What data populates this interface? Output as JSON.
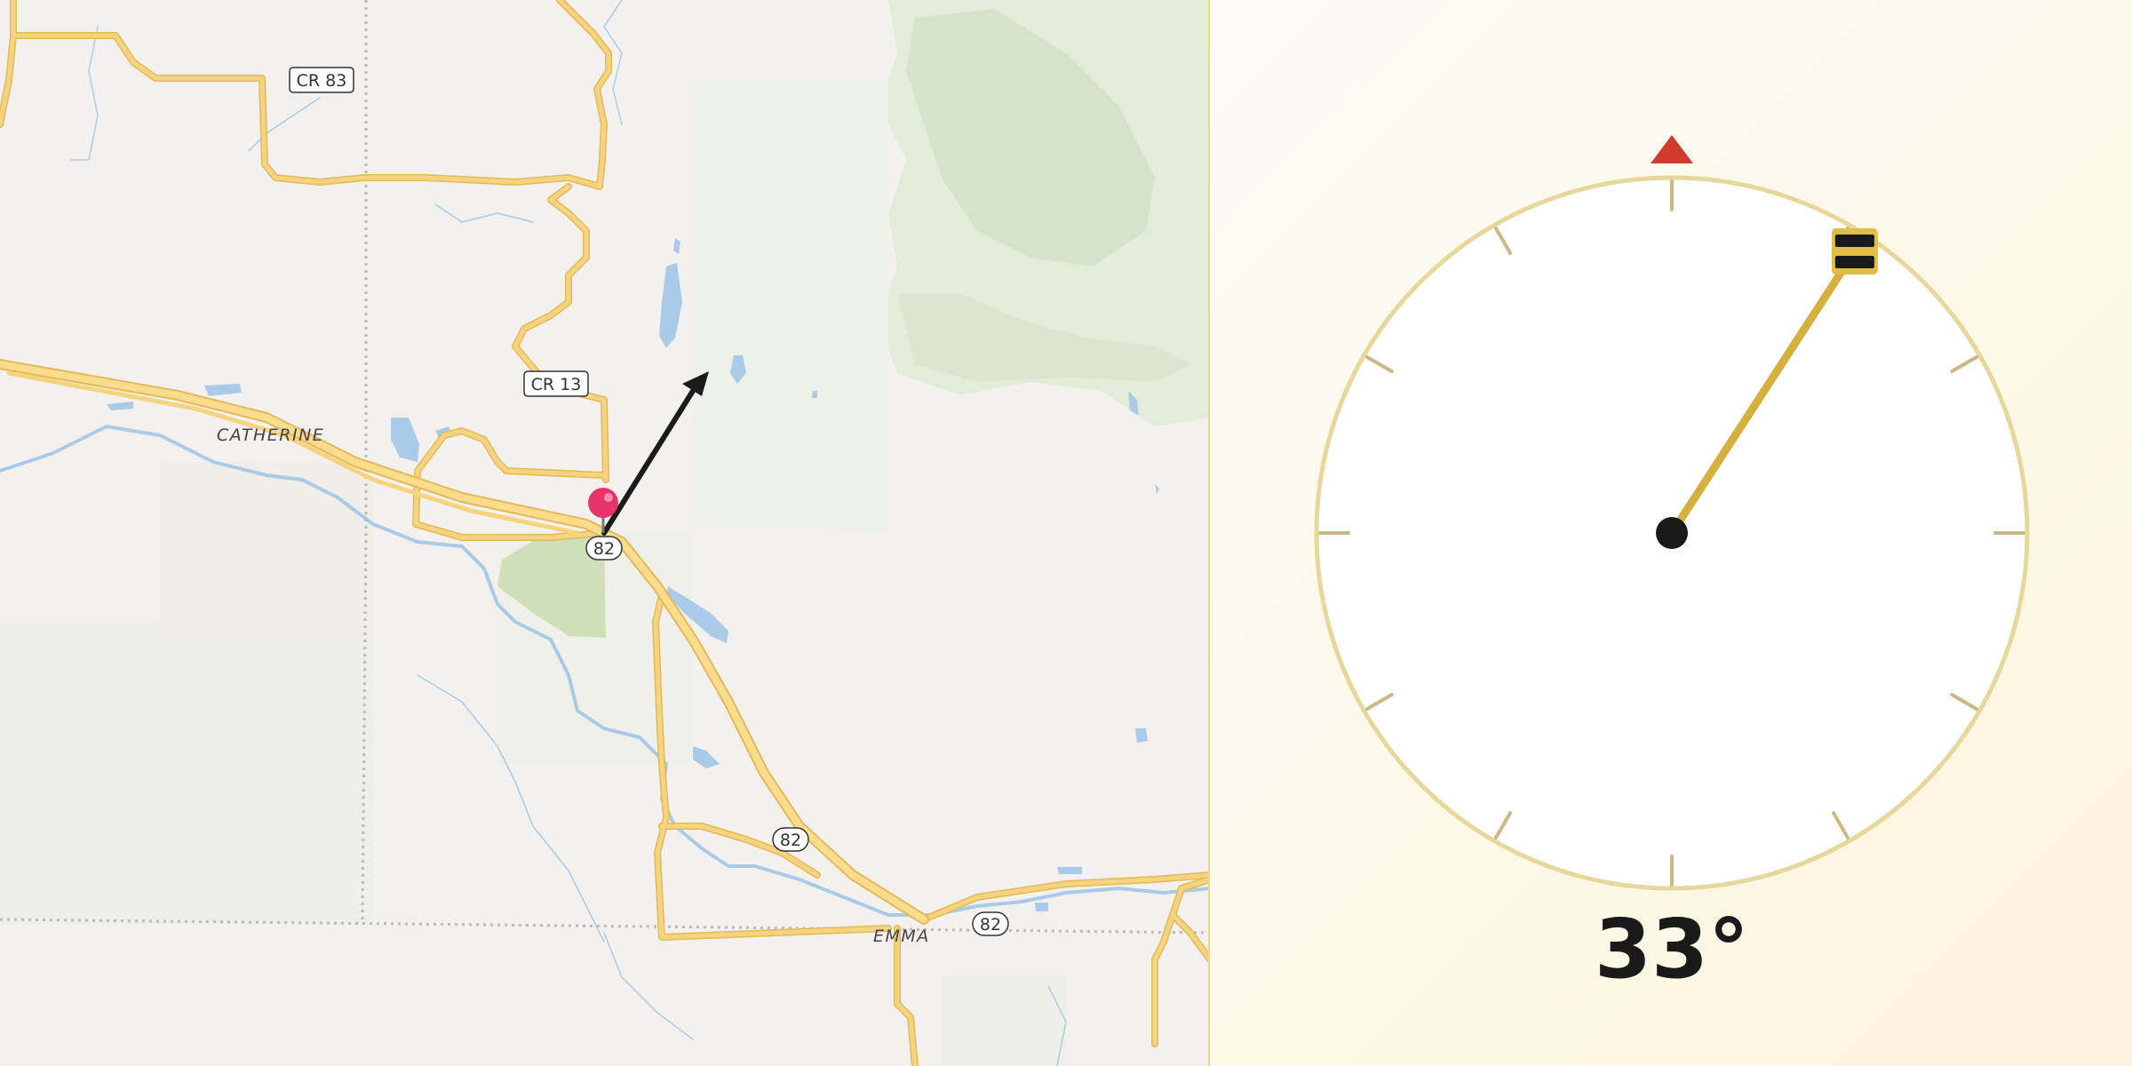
{
  "map": {
    "road_labels": {
      "cr83": "CR 83",
      "cr13": "CR 13",
      "hwy82_a": "82",
      "hwy82_b": "82",
      "hwy82_c": "82"
    },
    "place_labels": {
      "catherine": "CATHERINE",
      "emma": "EMMA"
    },
    "colors": {
      "road": "#f6d47f",
      "road_casing": "#e3b95a",
      "water": "#a9cbe8",
      "forest": "#dbe6d2",
      "park": "#cfe0b8",
      "background": "#f3f1ee"
    },
    "marker": {
      "icon": "map-pin-icon",
      "color": "#e8336b"
    },
    "direction_arrow": {
      "icon": "heading-arrow-icon",
      "bearing_deg": 33
    }
  },
  "compass": {
    "heading_label": "33°",
    "heading_deg": 33,
    "north_indicator": "north-triangle-icon",
    "needle_color": "#d4b03c",
    "north_color": "#d03b2f"
  }
}
